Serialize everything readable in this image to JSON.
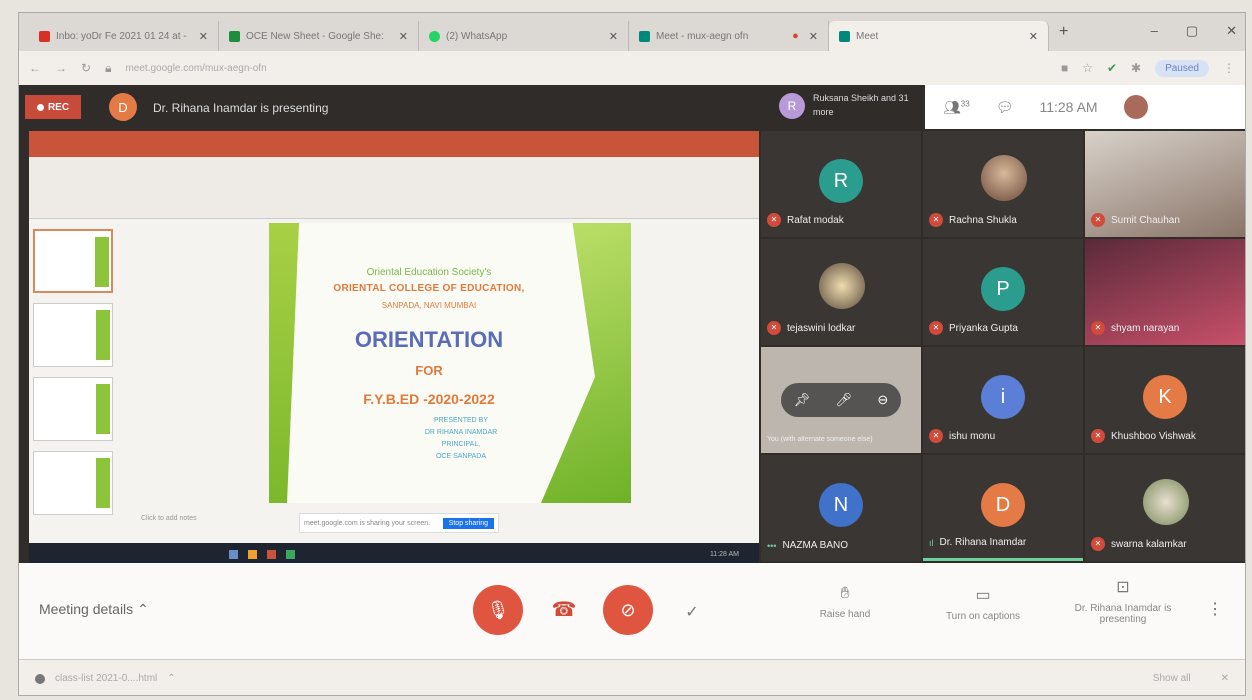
{
  "browser": {
    "tabs": [
      {
        "label": "Inbo: yoDr Fe 2021 01 24 at -",
        "color": "#d93025"
      },
      {
        "label": "OCE New Sheet - Google She:",
        "color": "#1e8e3e"
      },
      {
        "label": "(2) WhatsApp",
        "color": "#25d366"
      },
      {
        "label": "Meet - mux-aegn ofn",
        "color": "#00897b"
      },
      {
        "label": "Meet",
        "color": "#00897b"
      }
    ],
    "new_tab": "+",
    "window_controls": [
      "–",
      "▢",
      "✕"
    ],
    "url": "meet.google.com/mux-aegn-ofn",
    "paused_label": "Paused"
  },
  "meet": {
    "rec_label": "REC",
    "presenter_initial": "D",
    "presenting_text": "Dr. Rihana Inamdar is presenting",
    "others_initial": "R",
    "others_text": "Ruksana Sheikh and 31 more",
    "people_count": "33",
    "time": "11:28 AM",
    "you_label": "You"
  },
  "slide": {
    "line1": "Oriental Education Society's",
    "line2": "ORIENTAL COLLEGE OF EDUCATION,",
    "line3": "SANPADA, NAVI MUMBAI",
    "title": "ORIENTATION",
    "for": "FOR",
    "course": "F.Y.B.ED -2020-2022",
    "presented_by": "PRESENTED BY",
    "presenter": "DR RIHANA INAMDAR",
    "role": "PRINCIPAL,",
    "college": "OCE SANPADA",
    "notes_hint": "Click to add notes",
    "share_text": "meet.google.com is sharing your screen.",
    "stop_label": "Stop sharing",
    "taskbar_time": "11:28 AM"
  },
  "participants": [
    {
      "name": "Rafat modak",
      "initial": "R",
      "color": "#2a9d8f"
    },
    {
      "name": "Rachna Shukla",
      "initial": "",
      "color": ""
    },
    {
      "name": "Sumit Chauhan",
      "initial": "",
      "color": ""
    },
    {
      "name": "tejaswini lodkar",
      "initial": "",
      "color": ""
    },
    {
      "name": "Priyanka Gupta",
      "initial": "P",
      "color": "#2a9d8f"
    },
    {
      "name": "shyam narayan",
      "initial": "",
      "color": ""
    },
    {
      "name": "You (with alternate someone else)",
      "initial": "",
      "color": ""
    },
    {
      "name": "ishu monu",
      "initial": "i",
      "color": "#5b7fd6"
    },
    {
      "name": "Khushboo Vishwak",
      "initial": "K",
      "color": "#e47a45"
    },
    {
      "name": "NAZMA BANO",
      "initial": "N",
      "color": "#3f72c8"
    },
    {
      "name": "Dr. Rihana Inamdar",
      "initial": "D",
      "color": "#e47a45"
    },
    {
      "name": "swarna kalamkar",
      "initial": "",
      "color": ""
    }
  ],
  "controls": {
    "meeting_details": "Meeting details",
    "raise_hand": "Raise hand",
    "captions": "Turn on captions",
    "presenting": "Dr. Rihana Inamdar is presenting"
  },
  "downloads": {
    "file": "class-list 2021-0....html",
    "show_all": "Show all"
  }
}
